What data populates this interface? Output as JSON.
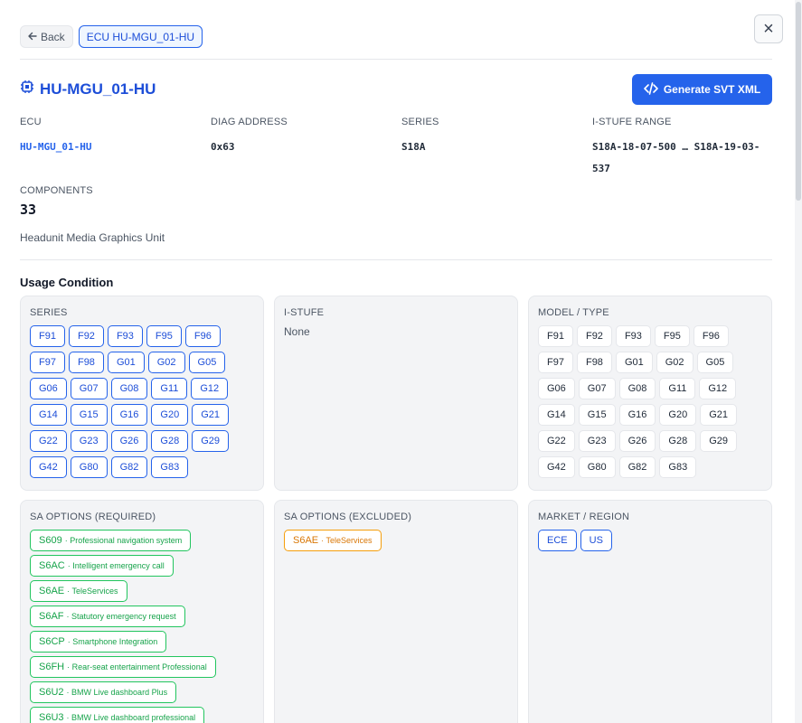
{
  "header": {
    "back_label": "Back",
    "breadcrumb": "ECU HU-MGU_01-HU",
    "close_label": "×"
  },
  "title": "HU-MGU_01-HU",
  "generate_button_label": "Generate SVT XML",
  "info": {
    "ecu_label": "ECU",
    "ecu_value": "HU-MGU_01-HU",
    "diag_label": "DIAG ADDRESS",
    "diag_value": "0x63",
    "series_label": "SERIES",
    "series_value": "S18A",
    "istufe_label": "I-STUFE RANGE",
    "istufe_value": "S18A-18-07-500 … S18A-19-03-537",
    "components_label": "COMPONENTS",
    "components_value": "33",
    "description": "Headunit Media Graphics Unit"
  },
  "usage": {
    "title": "Usage Condition",
    "series_panel": {
      "title": "SERIES",
      "items": [
        "F91",
        "F92",
        "F93",
        "F95",
        "F96",
        "F97",
        "F98",
        "G01",
        "G02",
        "G05",
        "G06",
        "G07",
        "G08",
        "G11",
        "G12",
        "G14",
        "G15",
        "G16",
        "G20",
        "G21",
        "G22",
        "G23",
        "G26",
        "G28",
        "G29",
        "G42",
        "G80",
        "G82",
        "G83"
      ]
    },
    "istufe_panel": {
      "title": "I-STUFE",
      "value": "None"
    },
    "model_panel": {
      "title": "MODEL / TYPE",
      "items": [
        "F91",
        "F92",
        "F93",
        "F95",
        "F96",
        "F97",
        "F98",
        "G01",
        "G02",
        "G05",
        "G06",
        "G07",
        "G08",
        "G11",
        "G12",
        "G14",
        "G15",
        "G16",
        "G20",
        "G21",
        "G22",
        "G23",
        "G26",
        "G28",
        "G29",
        "G42",
        "G80",
        "G82",
        "G83"
      ]
    },
    "sa_required_panel": {
      "title": "SA OPTIONS (REQUIRED)",
      "items": [
        {
          "code": "S609",
          "desc": "· Professional navigation system"
        },
        {
          "code": "S6AC",
          "desc": "· Intelligent emergency call"
        },
        {
          "code": "S6AE",
          "desc": "· TeleServices"
        },
        {
          "code": "S6AF",
          "desc": "· Statutory emergency request"
        },
        {
          "code": "S6CP",
          "desc": "· Smartphone Integration"
        },
        {
          "code": "S6FH",
          "desc": "· Rear-seat entertainment Professional"
        },
        {
          "code": "S6U2",
          "desc": "· BMW Live dashboard Plus"
        },
        {
          "code": "S6U3",
          "desc": "· BMW Live dashboard professional"
        }
      ]
    },
    "sa_excluded_panel": {
      "title": "SA OPTIONS (EXCLUDED)",
      "items": [
        {
          "code": "S6AE",
          "desc": "· TeleServices"
        }
      ]
    },
    "market_panel": {
      "title": "MARKET / REGION",
      "items": [
        "ECE",
        "US"
      ]
    }
  },
  "colors": {
    "primary": "#2563eb",
    "success": "#16a34a",
    "warning": "#d97706"
  }
}
